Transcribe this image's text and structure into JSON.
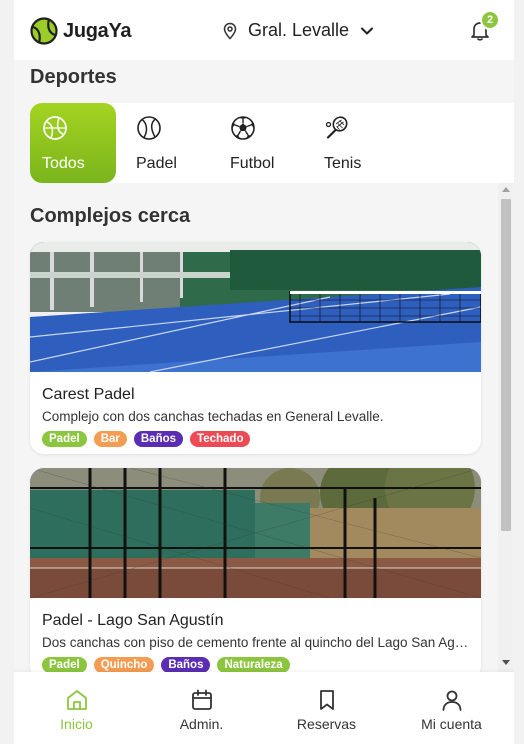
{
  "app": {
    "name": "JugaYa"
  },
  "header": {
    "location": "Gral. Levalle",
    "notifications_count": "2"
  },
  "sports": {
    "title": "Deportes",
    "items": [
      {
        "label": "Todos",
        "icon": "all-sports-icon",
        "active": true
      },
      {
        "label": "Padel",
        "icon": "padel-ball-icon",
        "active": false
      },
      {
        "label": "Futbol",
        "icon": "soccer-ball-icon",
        "active": false
      },
      {
        "label": "Tenis",
        "icon": "tennis-racket-icon",
        "active": false
      }
    ]
  },
  "complexes": {
    "title": "Complejos cerca",
    "items": [
      {
        "name": "Carest Padel",
        "description": "Complejo con dos canchas techadas en General Levalle.",
        "tags": [
          {
            "label": "Padel",
            "color": "#8cc63f"
          },
          {
            "label": "Bar",
            "color": "#f49c52"
          },
          {
            "label": "Baños",
            "color": "#5b2db3"
          },
          {
            "label": "Techado",
            "color": "#ec4a54"
          }
        ]
      },
      {
        "name": "Padel - Lago San Agustín",
        "description": "Dos canchas con piso de cemento frente al quincho del Lago San Agustín.",
        "tags": [
          {
            "label": "Padel",
            "color": "#8cc63f"
          },
          {
            "label": "Quincho",
            "color": "#f49c52"
          },
          {
            "label": "Baños",
            "color": "#5b2db3"
          },
          {
            "label": "Naturaleza",
            "color": "#8cc63f"
          }
        ]
      }
    ]
  },
  "nav": {
    "items": [
      {
        "label": "Inicio",
        "icon": "home-icon",
        "active": true
      },
      {
        "label": "Admin.",
        "icon": "calendar-icon",
        "active": false
      },
      {
        "label": "Reservas",
        "icon": "bookmark-icon",
        "active": false
      },
      {
        "label": "Mi cuenta",
        "icon": "user-icon",
        "active": false
      }
    ]
  },
  "colors": {
    "accent": "#8cc63f",
    "accent_dark": "#7ab51d"
  }
}
